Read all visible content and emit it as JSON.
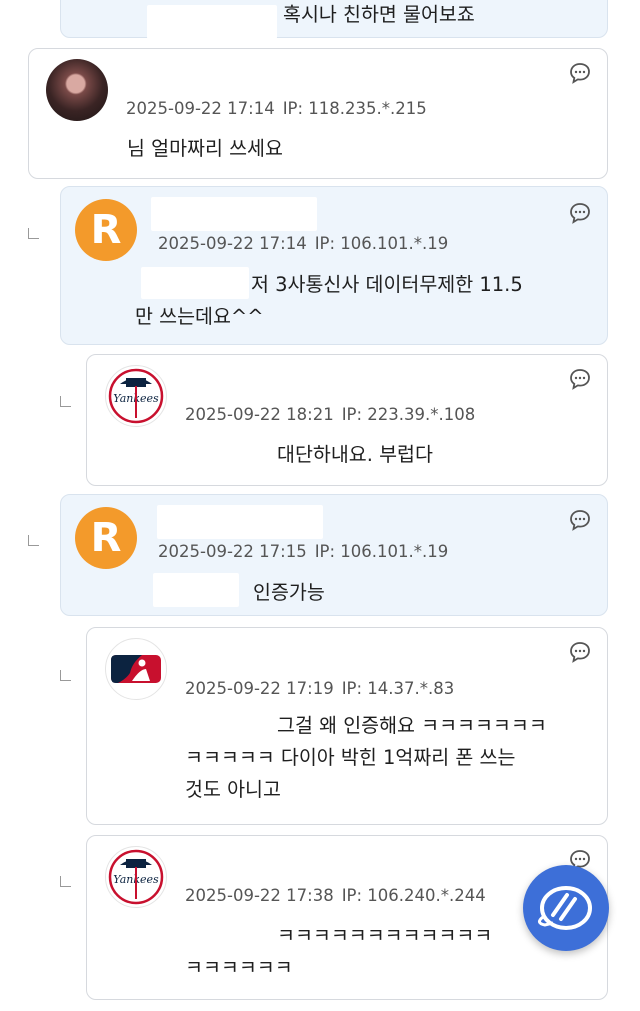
{
  "comments": [
    {
      "text_lines": [
        "혹시나 친하면 물어보죠"
      ]
    },
    {
      "date": "2025-09-22 17:14",
      "ip": "IP: 118.235.*.215",
      "text_lines": [
        "님 얼마짜리 쓰세요"
      ]
    },
    {
      "date": "2025-09-22 17:14",
      "ip": "IP: 106.101.*.19",
      "avatar_letter": "R",
      "text_lines": [
        "저 3사통신사 데이터무제한 11.5",
        "만 쓰는데요^^"
      ]
    },
    {
      "date": "2025-09-22 18:21",
      "ip": "IP: 223.39.*.108",
      "text_lines": [
        "대단하내요. 부럽다"
      ]
    },
    {
      "date": "2025-09-22 17:15",
      "ip": "IP: 106.101.*.19",
      "avatar_letter": "R",
      "text_lines": [
        "인증가능"
      ]
    },
    {
      "date": "2025-09-22 17:19",
      "ip": "IP: 14.37.*.83",
      "text_lines": [
        "그걸 왜 인증해요 ㅋㅋㅋㅋㅋㅋㅋ",
        "ㅋㅋㅋㅋㅋ 다이아 박힌 1억짜리 폰 쓰는",
        "것도 아니고"
      ]
    },
    {
      "date": "2025-09-22 17:38",
      "ip": "IP: 106.240.*.244",
      "text_lines": [
        "ㅋㅋㅋㅋㅋㅋㅋㅋㅋㅋㅋㅋ",
        "ㅋㅋㅋㅋㅋㅋ"
      ]
    }
  ],
  "icons": {
    "reply": "reply-bubble-icon",
    "fab": "floating-chat-icon",
    "yankees": "yankees-logo-icon",
    "mlb": "mlb-logo-icon"
  },
  "colors": {
    "reply_card_bg": "#eef5fc",
    "avatar_r": "#f39a2b",
    "fab": "#3d6fd8"
  }
}
